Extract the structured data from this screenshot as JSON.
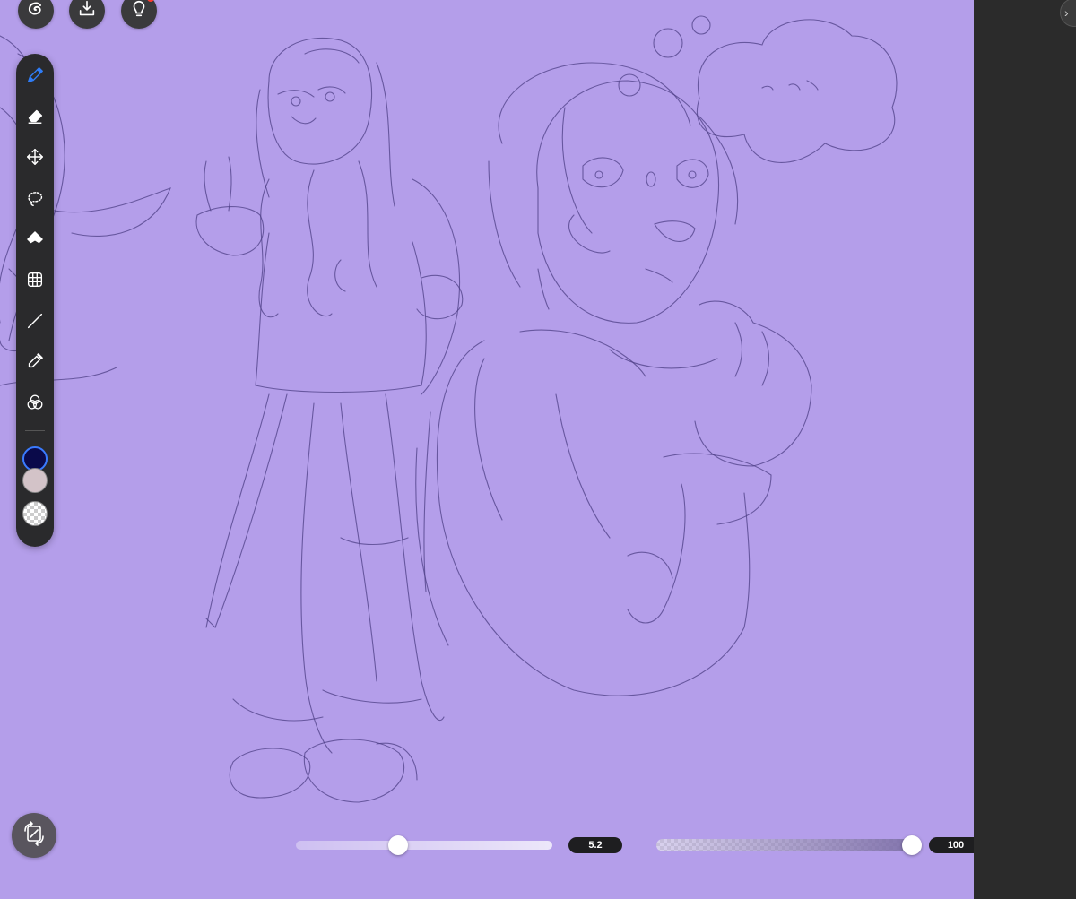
{
  "top_bar": {
    "buttons": [
      {
        "icon": "app-logo-icon"
      },
      {
        "icon": "download-tray-icon"
      },
      {
        "icon": "lightbulb-icon",
        "notification": true
      }
    ]
  },
  "toolbar": {
    "tools": [
      {
        "icon": "pen-icon",
        "selected": true
      },
      {
        "icon": "eraser-icon"
      },
      {
        "icon": "move-icon"
      },
      {
        "icon": "lasso-icon"
      },
      {
        "icon": "paint-bucket-icon"
      },
      {
        "icon": "transform-grid-icon"
      },
      {
        "icon": "line-icon"
      },
      {
        "icon": "eyedropper-icon"
      },
      {
        "icon": "color-blend-icon"
      }
    ],
    "colors": {
      "primary": "#0a0a4a",
      "secondary": "#d3c3c8",
      "transparent": "checker"
    }
  },
  "canvas": {
    "background_color": "#b49eea",
    "stroke_color": "#4d3f85"
  },
  "brush": {
    "size_value": "5.2",
    "size_level": 0.4,
    "opacity_value": "100",
    "opacity_level": 1.0
  },
  "flip_button": {
    "icon": "flip-canvas-icon"
  },
  "panel": {
    "corner_icon": "chevron-icon"
  }
}
